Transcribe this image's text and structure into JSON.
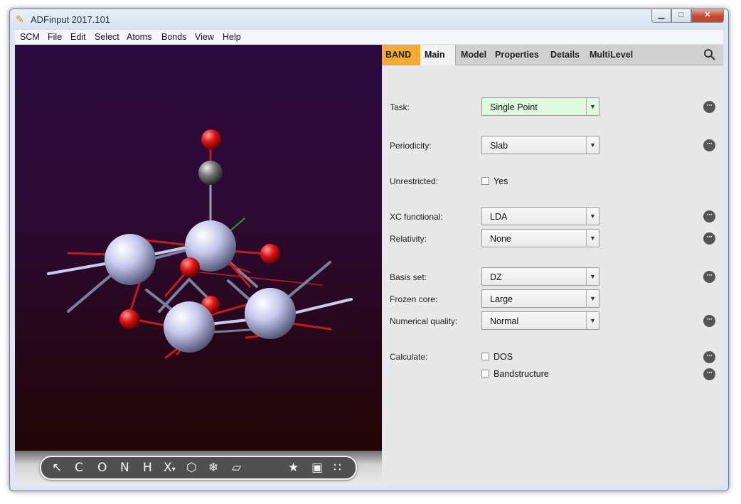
{
  "window": {
    "title": "ADFinput 2017.101",
    "controls": {
      "minimize": "▁",
      "maximize": "□",
      "close": "✕"
    }
  },
  "menu": [
    "SCM",
    "File",
    "Edit",
    "Select",
    "Atoms",
    "Bonds",
    "View",
    "Help"
  ],
  "toolbar": {
    "tools": [
      "pointer",
      "C",
      "O",
      "N",
      "H",
      "X",
      "ring",
      "symmetry",
      "plane",
      "star",
      "cell",
      "dots"
    ],
    "x_suffix": "▾"
  },
  "tabs": {
    "band": "BAND",
    "main": "Main",
    "others": [
      "Model",
      "Properties",
      "Details",
      "MultiLevel"
    ]
  },
  "form": {
    "task": {
      "label": "Task:",
      "value": "Single Point"
    },
    "periodicity": {
      "label": "Periodicity:",
      "value": "Slab"
    },
    "unrestricted": {
      "label": "Unrestricted:",
      "option": "Yes"
    },
    "xc": {
      "label": "XC functional:",
      "value": "LDA"
    },
    "relativity": {
      "label": "Relativity:",
      "value": "None"
    },
    "basis": {
      "label": "Basis set:",
      "value": "DZ"
    },
    "frozen": {
      "label": "Frozen core:",
      "value": "Large"
    },
    "quality": {
      "label": "Numerical quality:",
      "value": "Normal"
    },
    "calculate": {
      "label": "Calculate:",
      "options": [
        "DOS",
        "Bandstructure"
      ]
    }
  },
  "colors": {
    "band_tab": "#f3ab32",
    "task_field": "#dffadf",
    "metal_atom": "#d8dcf4",
    "oxygen_atom": "#e01515",
    "carbon_atom": "#555555"
  },
  "icons": {
    "more": "more-options-icon",
    "search": "search-icon",
    "dropdown": "chevron-down-icon"
  }
}
